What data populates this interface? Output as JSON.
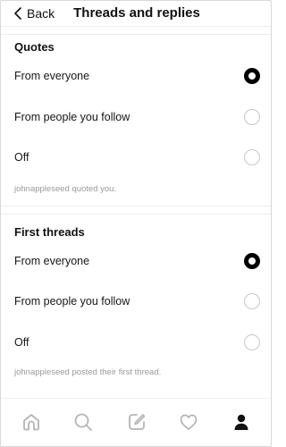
{
  "header": {
    "back_label": "Back",
    "title": "Threads and replies"
  },
  "sections": [
    {
      "title": "Quotes",
      "options": [
        {
          "label": "From everyone",
          "selected": true
        },
        {
          "label": "From people you follow",
          "selected": false
        },
        {
          "label": "Off",
          "selected": false
        }
      ],
      "note": "johnappleseed quoted you."
    },
    {
      "title": "First threads",
      "options": [
        {
          "label": "From everyone",
          "selected": true
        },
        {
          "label": "From people you follow",
          "selected": false
        },
        {
          "label": "Off",
          "selected": false
        }
      ],
      "note": "johnappleseed posted their first thread."
    }
  ],
  "tabbar": {
    "icons": [
      "home-icon",
      "search-icon",
      "compose-icon",
      "heart-icon",
      "profile-icon"
    ],
    "active": "profile-icon",
    "active_color": "#111111",
    "inactive_color": "#b5b5b5"
  }
}
